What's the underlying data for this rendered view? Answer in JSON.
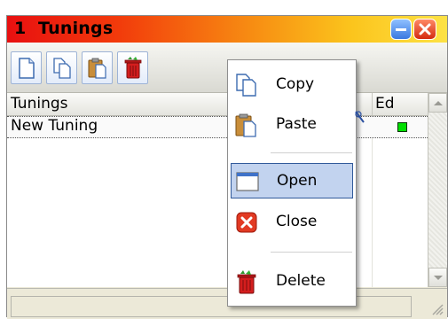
{
  "window": {
    "title": "1  Tunings"
  },
  "toolbar": {
    "buttons": [
      {
        "icon": "new-document-icon"
      },
      {
        "icon": "copy-icon"
      },
      {
        "icon": "paste-icon"
      },
      {
        "icon": "delete-icon"
      }
    ]
  },
  "list": {
    "columns": {
      "name": "Tunings",
      "edit": "Ed"
    },
    "rows": [
      {
        "name": "New Tuning",
        "edit_status_color": "#00e000"
      }
    ]
  },
  "context_menu": {
    "items": [
      {
        "label": "Copy",
        "icon": "copy-icon"
      },
      {
        "label": "Paste",
        "icon": "paste-icon"
      },
      {
        "label": "Open",
        "icon": "open-window-icon",
        "selected": true
      },
      {
        "label": "Close",
        "icon": "close-red-icon"
      },
      {
        "label": "Delete",
        "icon": "trash-icon"
      }
    ]
  },
  "colors": {
    "menu_highlight": "#c2d3ef",
    "menu_highlight_border": "#315a9b"
  }
}
